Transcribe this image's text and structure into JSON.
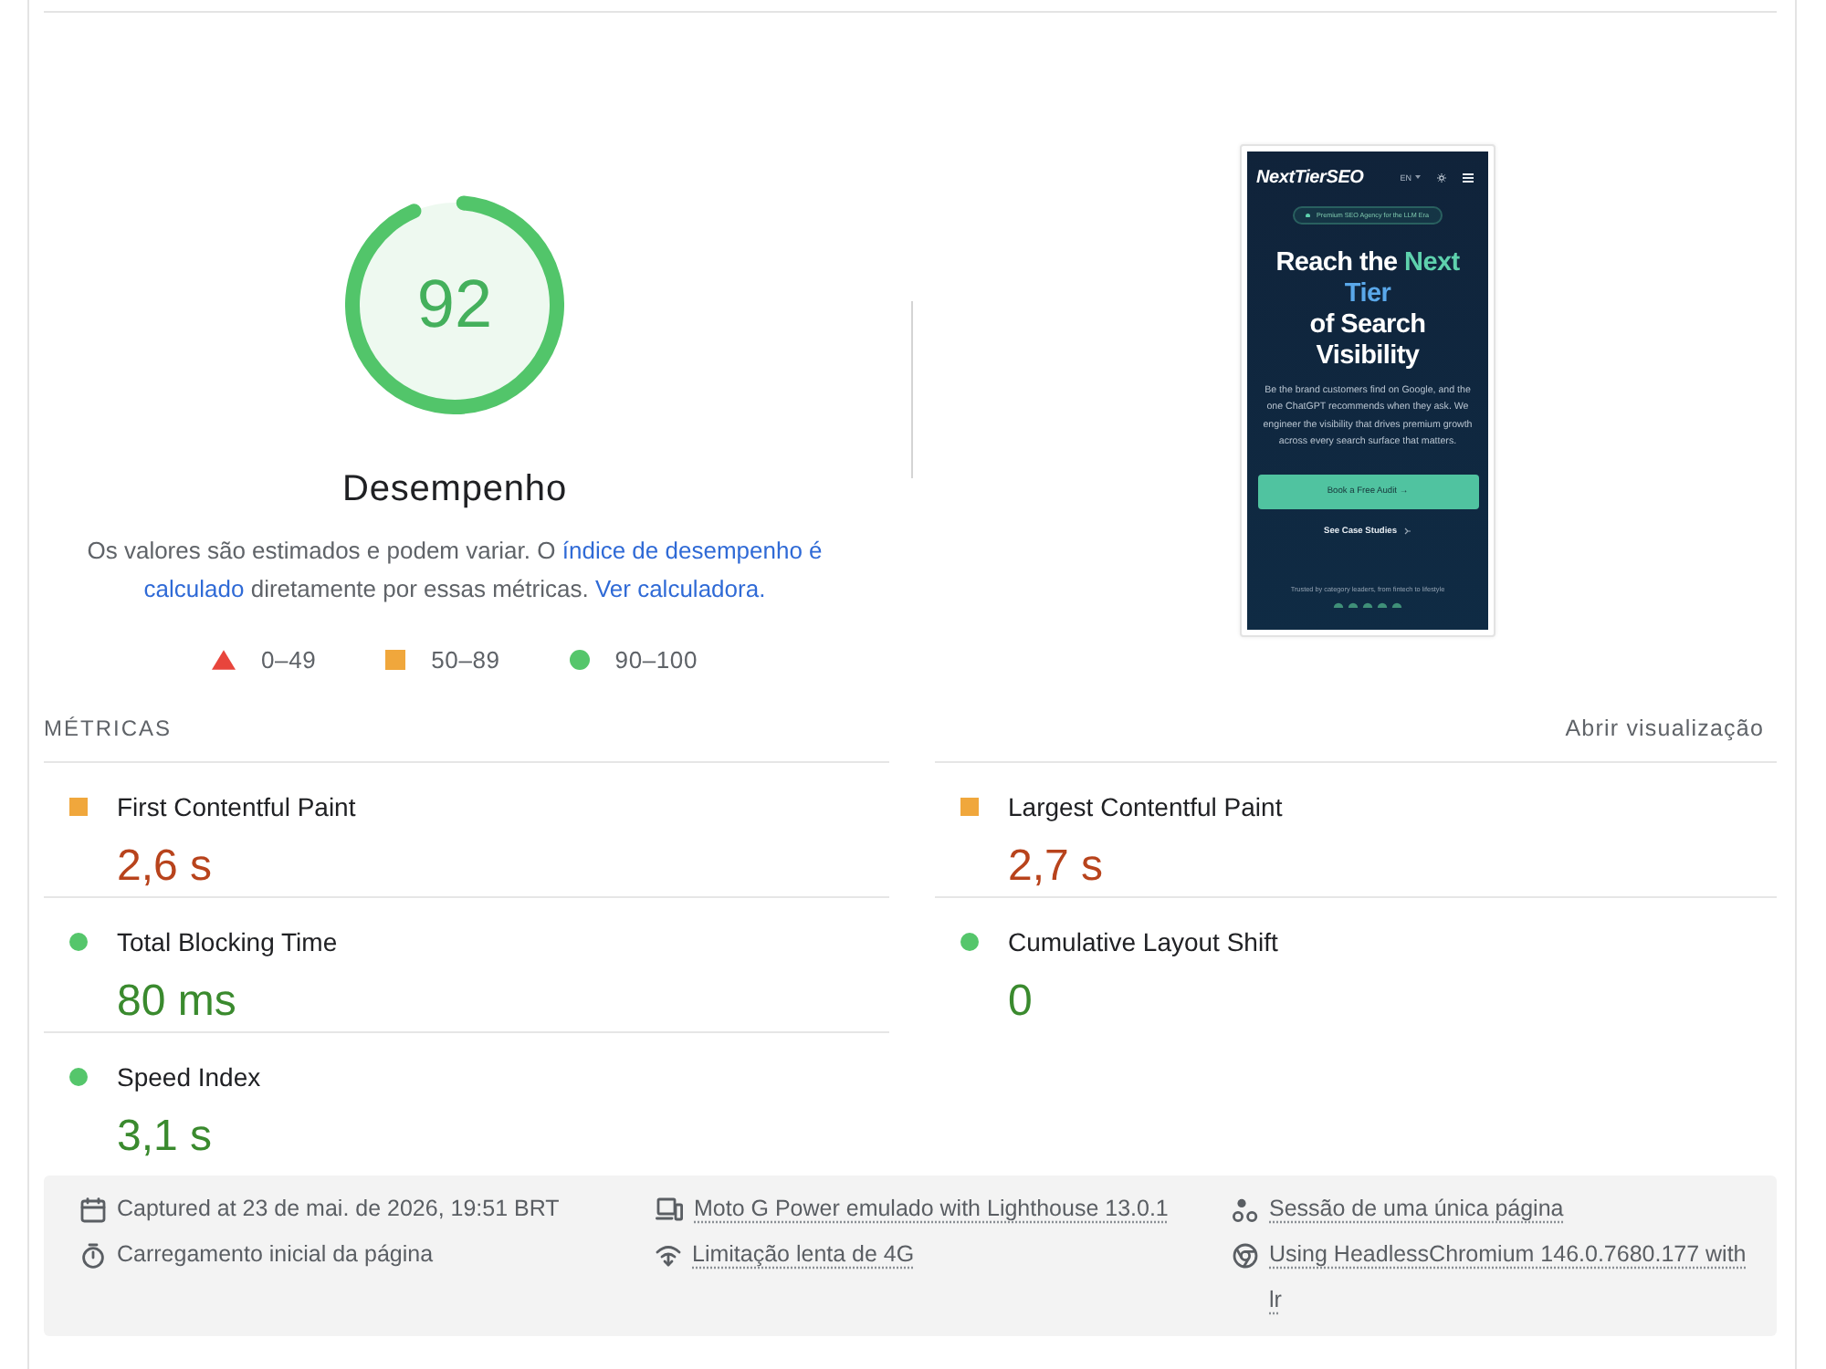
{
  "score": {
    "value": "92",
    "level": 0.92,
    "title": "Desempenho",
    "description": [
      {
        "kind": "text",
        "text": "Os valores são estimados e podem variar. O"
      },
      {
        "kind": "link",
        "text": "índice de desempenho é"
      },
      {
        "kind": "link",
        "text": "calculado"
      },
      {
        "kind": "text",
        "text": "diretamente por essas métricas."
      },
      {
        "kind": "link",
        "text": "Ver calculadora."
      }
    ],
    "legend": [
      {
        "kind": "fail",
        "label": "0–49"
      },
      {
        "kind": "average",
        "label": "50–89"
      },
      {
        "kind": "pass",
        "label": "90–100"
      }
    ]
  },
  "preview": {
    "logo": "NextTierSEO",
    "language": "EN",
    "badge": "Premium SEO Agency for the LLM Era",
    "headline": [
      [
        {
          "kind": "plain",
          "text": "Reach the"
        },
        {
          "kind": "accent",
          "text": "Next"
        }
      ],
      [
        {
          "kind": "highlight",
          "text": "Tier"
        }
      ],
      [
        {
          "kind": "plain",
          "text": "of Search"
        }
      ],
      [
        {
          "kind": "plain",
          "text": "Visibility"
        }
      ]
    ],
    "body": "Be the brand customers find on Google, and the one ChatGPT recommends when they ask. We engineer the visibility that drives premium growth across every search surface that matters.",
    "primary_button": "Book a Free Audit →",
    "secondary_link": "See Case Studies",
    "trust_text": "Trusted by category leaders, from fintech to lifestyle"
  },
  "metrics": {
    "title": "MÉTRICAS",
    "toggle": "Abrir visualização",
    "items": [
      {
        "name": "First Contentful Paint",
        "value": "2,6 s",
        "kind": "average"
      },
      {
        "name": "Largest Contentful Paint",
        "value": "2,7 s",
        "kind": "average"
      },
      {
        "name": "Total Blocking Time",
        "value": "80 ms",
        "kind": "pass"
      },
      {
        "name": "Cumulative Layout Shift",
        "value": "0",
        "kind": "pass"
      },
      {
        "name": "Speed Index",
        "value": "3,1 s",
        "kind": "pass"
      }
    ]
  },
  "footer": {
    "items": [
      {
        "kind": "plain",
        "text": "Captured at 23 de mai. de 2026, 19:51 BRT"
      },
      {
        "kind": "hint",
        "text": "Moto G Power emulado with Lighthouse 13.0.1"
      },
      {
        "kind": "hint",
        "text": "Sessão de uma única página"
      },
      {
        "kind": "plain",
        "text": "Carregamento inicial da página"
      },
      {
        "kind": "hint",
        "text": "Limitação lenta de 4G"
      },
      {
        "kind": "hint",
        "text": "Using HeadlessChromium 146.0.7680.177 with lr"
      }
    ]
  }
}
